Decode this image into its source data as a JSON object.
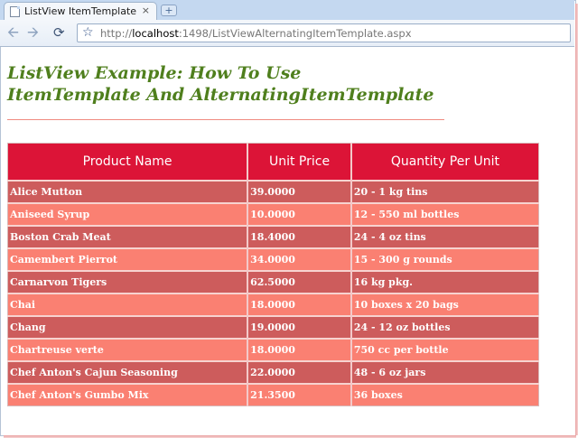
{
  "browser": {
    "tab_title": "ListView ItemTemplate and ...",
    "tab_close": "×",
    "new_tab": "+",
    "url_prefix": "http://",
    "url_host": "localhost",
    "url_path": ":1498/ListViewAlternatingItemTemplate.aspx"
  },
  "page": {
    "heading_line1": "ListView Example: How To Use",
    "heading_line2": "ItemTemplate And AlternatingItemTemplate"
  },
  "table": {
    "columns": [
      "Product Name",
      "Unit Price",
      "Quantity Per Unit"
    ],
    "rows": [
      [
        "Alice Mutton",
        "39.0000",
        "20 - 1 kg tins"
      ],
      [
        "Aniseed Syrup",
        "10.0000",
        "12 - 550 ml bottles"
      ],
      [
        "Boston Crab Meat",
        "18.4000",
        "24 - 4 oz tins"
      ],
      [
        "Camembert Pierrot",
        "34.0000",
        "15 - 300 g rounds"
      ],
      [
        "Carnarvon Tigers",
        "62.5000",
        "16 kg pkg."
      ],
      [
        "Chai",
        "18.0000",
        "10 boxes x 20 bags"
      ],
      [
        "Chang",
        "19.0000",
        "24 - 12 oz bottles"
      ],
      [
        "Chartreuse verte",
        "18.0000",
        "750 cc per bottle"
      ],
      [
        "Chef Anton's Cajun Seasoning",
        "22.0000",
        "48 - 6 oz jars"
      ],
      [
        "Chef Anton's Gumbo Mix",
        "21.3500",
        "36 boxes"
      ]
    ]
  },
  "colors": {
    "header_bg": "#dc1437",
    "item_row_bg": "#cd5c5c",
    "alternating_row_bg": "#fa8072",
    "heading_text": "#4f7f1d"
  }
}
